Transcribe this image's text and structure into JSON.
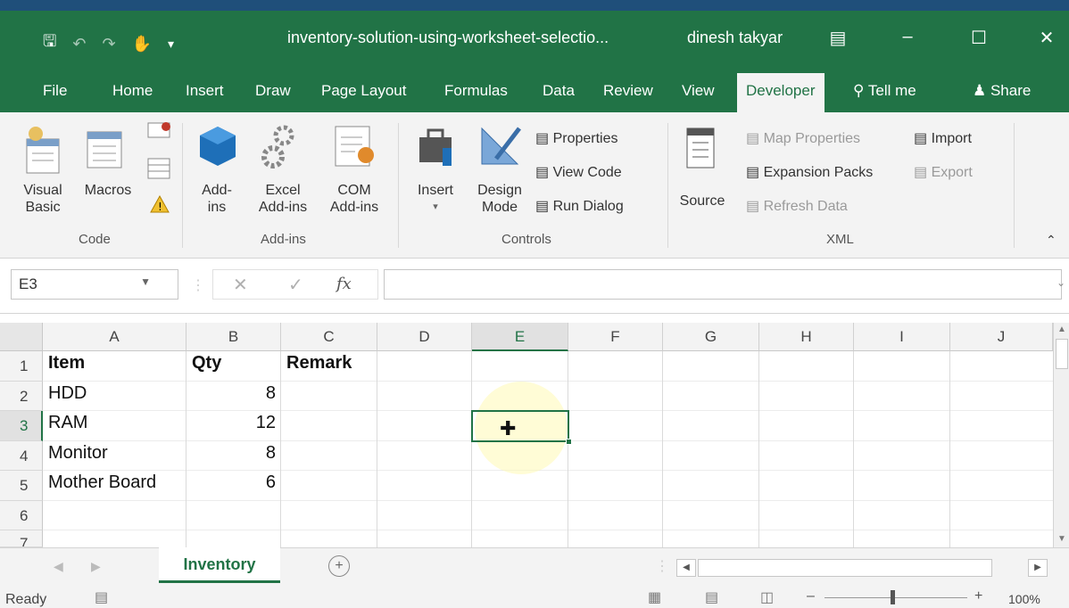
{
  "title_bar": {
    "doc_title": "inventory-solution-using-worksheet-selectio...",
    "user_name": "dinesh takyar"
  },
  "tabs": [
    {
      "label": "File"
    },
    {
      "label": "Home"
    },
    {
      "label": "Insert"
    },
    {
      "label": "Draw"
    },
    {
      "label": "Page Layout"
    },
    {
      "label": "Formulas"
    },
    {
      "label": "Data"
    },
    {
      "label": "Review"
    },
    {
      "label": "View"
    },
    {
      "label": "Developer"
    },
    {
      "label": "Tell me"
    },
    {
      "label": "Share"
    }
  ],
  "ribbon": {
    "code": {
      "group": "Code",
      "visual_basic": [
        "Visual",
        "Basic"
      ],
      "macros": "Macros"
    },
    "addins": {
      "group": "Add-ins",
      "add_ins": [
        "Add-",
        "ins"
      ],
      "excel_add_ins": [
        "Excel",
        "Add-ins"
      ],
      "com_add_ins": [
        "COM",
        "Add-ins"
      ]
    },
    "controls": {
      "group": "Controls",
      "insert": "Insert",
      "design_mode": [
        "Design",
        "Mode"
      ],
      "properties": "Properties",
      "view_code": "View Code",
      "run_dialog": "Run Dialog"
    },
    "xml": {
      "group": "XML",
      "source": "Source",
      "map_properties": "Map Properties",
      "expansion_packs": "Expansion Packs",
      "refresh_data": "Refresh Data",
      "import": "Import",
      "export": "Export"
    }
  },
  "formula_bar": {
    "name_box": "E3",
    "fx": "fx",
    "formula": ""
  },
  "grid": {
    "columns": [
      "A",
      "B",
      "C",
      "D",
      "E",
      "F",
      "G",
      "H",
      "I",
      "J"
    ],
    "rows": [
      "1",
      "2",
      "3",
      "4",
      "5",
      "6",
      "7"
    ],
    "cells": {
      "A1": "Item",
      "B1": "Qty",
      "C1": "Remark",
      "A2": "HDD",
      "B2": "8",
      "A3": "RAM",
      "B3": "12",
      "A4": "Monitor",
      "B4": "8",
      "A5": "Mother Board",
      "B5": "6"
    },
    "active_cell": "E3"
  },
  "sheets": {
    "active": "Inventory"
  },
  "status_bar": {
    "ready": "Ready",
    "zoom": "100%"
  }
}
